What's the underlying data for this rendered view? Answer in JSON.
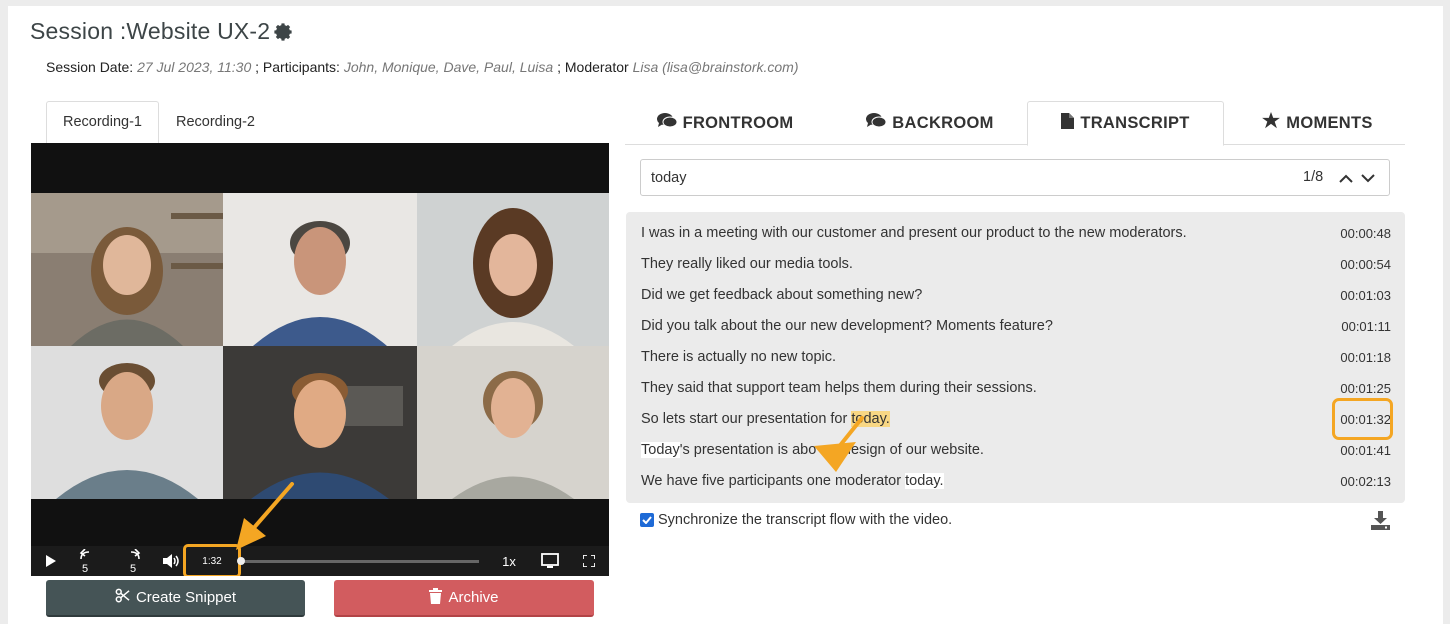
{
  "session": {
    "title": "Session :Website UX-2",
    "date_label": "Session Date:",
    "date_value": "27 Jul 2023, 11:30",
    "participants_label": "; Participants:",
    "participants_value": "John, Monique, Dave, Paul, Luisa",
    "moderator_label": "; Moderator",
    "moderator_value": "Lisa (lisa@brainstork.com)"
  },
  "recordings": [
    "Recording-1",
    "Recording-2"
  ],
  "player": {
    "current_time": "1:32",
    "speed": "1x",
    "progress": 0.0
  },
  "actions": {
    "snippet_label": "Create Snippet",
    "archive_label": "Archive"
  },
  "right_tabs": [
    {
      "label": "FRONTROOM",
      "icon": "comments-icon"
    },
    {
      "label": "BACKROOM",
      "icon": "comments-icon"
    },
    {
      "label": "TRANSCRIPT",
      "icon": "file-icon"
    },
    {
      "label": "MOMENTS",
      "icon": "star-icon"
    }
  ],
  "search": {
    "value": "today",
    "count": "1/8"
  },
  "transcript": [
    {
      "parts": [
        {
          "t": "I was in a meeting with our customer and present our product to the new moderators."
        }
      ],
      "time": "00:00:48"
    },
    {
      "parts": [
        {
          "t": "They really liked our media tools."
        }
      ],
      "time": "00:00:54"
    },
    {
      "parts": [
        {
          "t": "Did we get feedback about something new?"
        }
      ],
      "time": "00:01:03"
    },
    {
      "parts": [
        {
          "t": "Did you talk about the our new development? Moments feature?"
        }
      ],
      "time": "00:01:11"
    },
    {
      "parts": [
        {
          "t": "There is actually no new topic."
        }
      ],
      "time": "00:01:18"
    },
    {
      "parts": [
        {
          "t": "They  said that support team helps them during their sessions."
        }
      ],
      "time": "00:01:25"
    },
    {
      "parts": [
        {
          "t": "So lets start our presentation for "
        },
        {
          "t": "today.",
          "hl": "current"
        }
      ],
      "time": "00:01:32"
    },
    {
      "parts": [
        {
          "t": "Today",
          "hl": "match"
        },
        {
          "t": "'s presentation is abo"
        },
        {
          "t": "                 "
        },
        {
          "t": "ew design of our website."
        }
      ],
      "time": "00:01:41"
    },
    {
      "parts": [
        {
          "t": "We have five participants one moderator "
        },
        {
          "t": "today.",
          "hl": "match"
        }
      ],
      "time": "00:02:13"
    }
  ],
  "sync_label": "Synchronize the transcript flow with the video.",
  "colors": {
    "highlight_current": "#f8d784",
    "annotation": "#f4a623",
    "archive": "#d25c5f",
    "snippet": "#455456"
  }
}
